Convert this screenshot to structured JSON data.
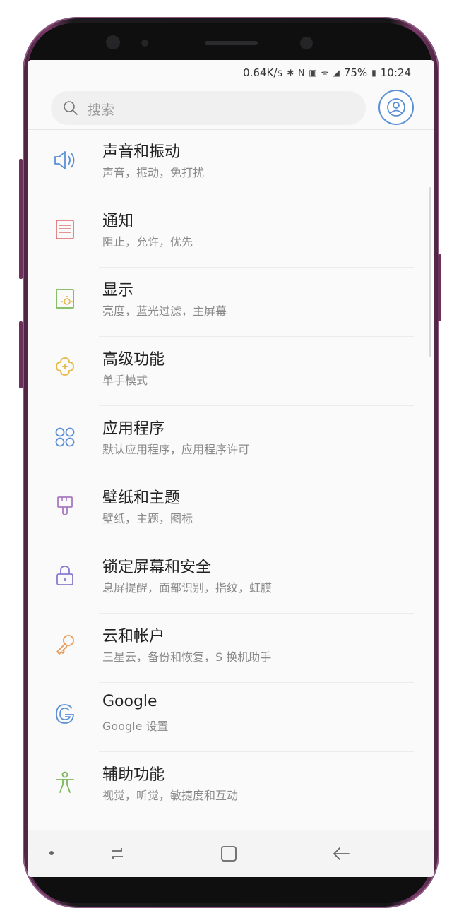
{
  "status_bar": {
    "speed": "0.64K/s",
    "battery": "75%",
    "time": "10:24"
  },
  "search": {
    "placeholder": "搜索"
  },
  "settings_items": [
    {
      "title": "声音和振动",
      "subtitle": "声音，振动，免打扰",
      "icon": "speaker-icon",
      "color": "#5b8fd6"
    },
    {
      "title": "通知",
      "subtitle": "阻止，允许，优先",
      "icon": "notification-icon",
      "color": "#e07a7a"
    },
    {
      "title": "显示",
      "subtitle": "亮度，蓝光过滤，主屏幕",
      "icon": "display-icon",
      "color": "#7ab85b"
    },
    {
      "title": "高级功能",
      "subtitle": "单手模式",
      "icon": "advanced-features-icon",
      "color": "#e5b84a"
    },
    {
      "title": "应用程序",
      "subtitle": "默认应用程序，应用程序许可",
      "icon": "apps-icon",
      "color": "#5b8fd6"
    },
    {
      "title": "壁纸和主题",
      "subtitle": "壁纸，主题，图标",
      "icon": "paintbrush-icon",
      "color": "#a87ac0"
    },
    {
      "title": "锁定屏幕和安全",
      "subtitle": "息屏提醒，面部识别，指纹，虹膜",
      "icon": "lock-icon",
      "color": "#8a7ad0"
    },
    {
      "title": "云和帐户",
      "subtitle": "三星云，备份和恢复，S 换机助手",
      "icon": "key-icon",
      "color": "#e89a5a"
    },
    {
      "title": "Google",
      "subtitle": "Google 设置",
      "icon": "google-icon",
      "color": "#5b8fd6"
    },
    {
      "title": "辅助功能",
      "subtitle": "视觉，听觉，敏捷度和互动",
      "icon": "accessibility-icon",
      "color": "#7ab85b"
    }
  ],
  "colors": {
    "accent": "#5b8fd6",
    "phone_frame": "#7a3a68"
  }
}
